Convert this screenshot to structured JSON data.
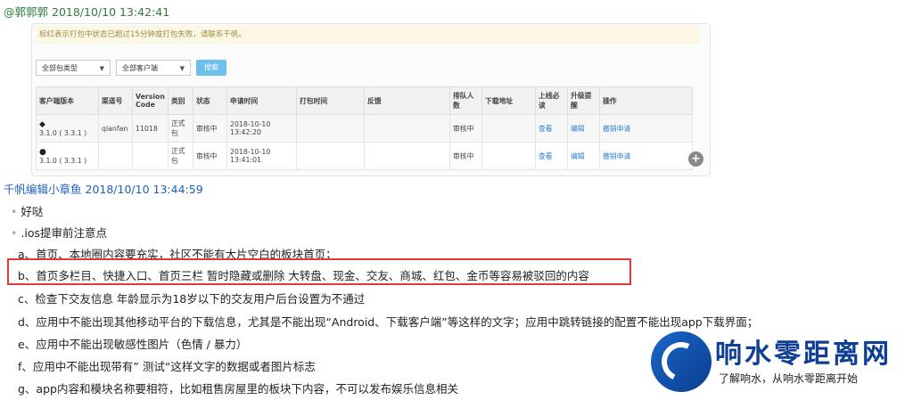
{
  "messages": [
    {
      "author": "@郭郭郭",
      "time": "2018/10/10 13:42:41"
    },
    {
      "author": "千帆编辑小章鱼",
      "time": "2018/10/10 13:44:59"
    }
  ],
  "panel": {
    "notice": "标红表示打包中状态已超过15分钟或打包失败，请联系千帆。",
    "filter_type": "全部包类型",
    "filter_client": "全部客户端",
    "search_label": "搜索",
    "columns": [
      "客户端版本",
      "渠道号",
      "Version Code",
      "类别",
      "状态",
      "申请时间",
      "打包时间",
      "反馈",
      "排队人数",
      "下载地址",
      "上线必读",
      "升级提醒",
      "操作"
    ],
    "rows": [
      {
        "platform_icon": "android-icon",
        "version": "3.1.0 ( 3.3.1 )",
        "channel": "qianfan",
        "code": "11018",
        "category": "正式包",
        "status": "审核中",
        "apply_time": "2018-10-10 13:42:20",
        "pack_time": "",
        "feedback": "",
        "queue": "审核中",
        "download": "",
        "must_read": "查看",
        "upgrade": "编辑",
        "action": "撤销申请"
      },
      {
        "platform_icon": "apple-icon",
        "version": "3.1.0 ( 3.3.1 )",
        "channel": "",
        "code": "",
        "category": "正式包",
        "status": "审核中",
        "apply_time": "2018-10-10 13:41:01",
        "pack_time": "",
        "feedback": "",
        "queue": "审核中",
        "download": "",
        "must_read": "查看",
        "upgrade": "编辑",
        "action": "撤销申请"
      }
    ]
  },
  "bullets": [
    "好哒",
    ".ios提审前注意点"
  ],
  "items": [
    "a、首页、本地圈内容要充实，社区不能有大片空白的板块首页；",
    "b、首页多栏目、快捷入口、首页三栏  暂时隐藏或删除 大转盘、现金、交友、商城、红包、金币等容易被驳回的内容",
    "c、检查下交友信息  年龄显示为18岁以下的交友用户后台设置为不通过",
    "d、应用中不能出现其他移动平台的下载信息，尤其是不能出现“Android、下载客户端”等这样的文字；应用中跳转链接的配置不能出现app下载界面；",
    "e、应用中不能出现敏感性图片（色情 / 暴力）",
    "f、应用中不能出现带有”  测试“这样文字的数据或者图片标志",
    "g、app内容和模块名称要相符，比如租售房屋里的板块下内容，不可以发布娱乐信息相关"
  ],
  "watermark": {
    "title": "响水零距离网",
    "subtitle": "了解响水，从响水零距离开始"
  },
  "colors": {
    "highlight_border": "#e23a3a",
    "link": "#2b7fd0",
    "author_green": "#2f7a3d",
    "author_blue": "#1f5fbf"
  }
}
